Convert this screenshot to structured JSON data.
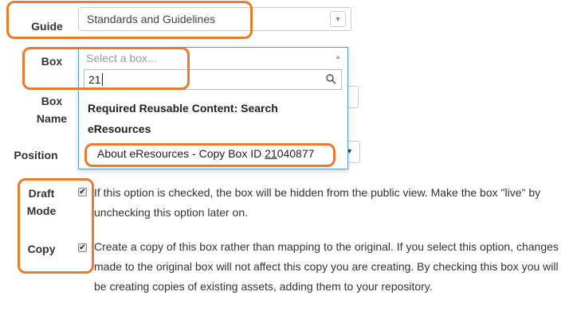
{
  "form": {
    "guide": {
      "label": "Guide",
      "value": "Standards and Guidelines"
    },
    "box": {
      "label": "Box",
      "placeholder": "Select a box...",
      "search_value": "21",
      "group_label_line1": "Required Reusable Content: Search",
      "group_label_line2": "eResources",
      "option_prefix": "About eResources - Copy Box ID ",
      "option_match": "21",
      "option_suffix": "040877"
    },
    "box_name": {
      "label_line1": "Box",
      "label_line2": "Name"
    },
    "position": {
      "label": "Position"
    },
    "draft_mode": {
      "label_line1": "Draft",
      "label_line2": "Mode",
      "checked": true,
      "description": "If this option is checked, the box will be hidden from the public view. Make the box \"live\" by unchecking this option later on."
    },
    "copy": {
      "label": "Copy",
      "checked": true,
      "description": "Create a copy of this box rather than mapping to the original. If you select this option, changes made to the original box will not affect this copy you are creating. By checking this box you will be creating copies of existing assets, adding them to your repository."
    }
  },
  "colors": {
    "highlight": "#e87b2c",
    "focus_border": "#5b9bd5"
  }
}
